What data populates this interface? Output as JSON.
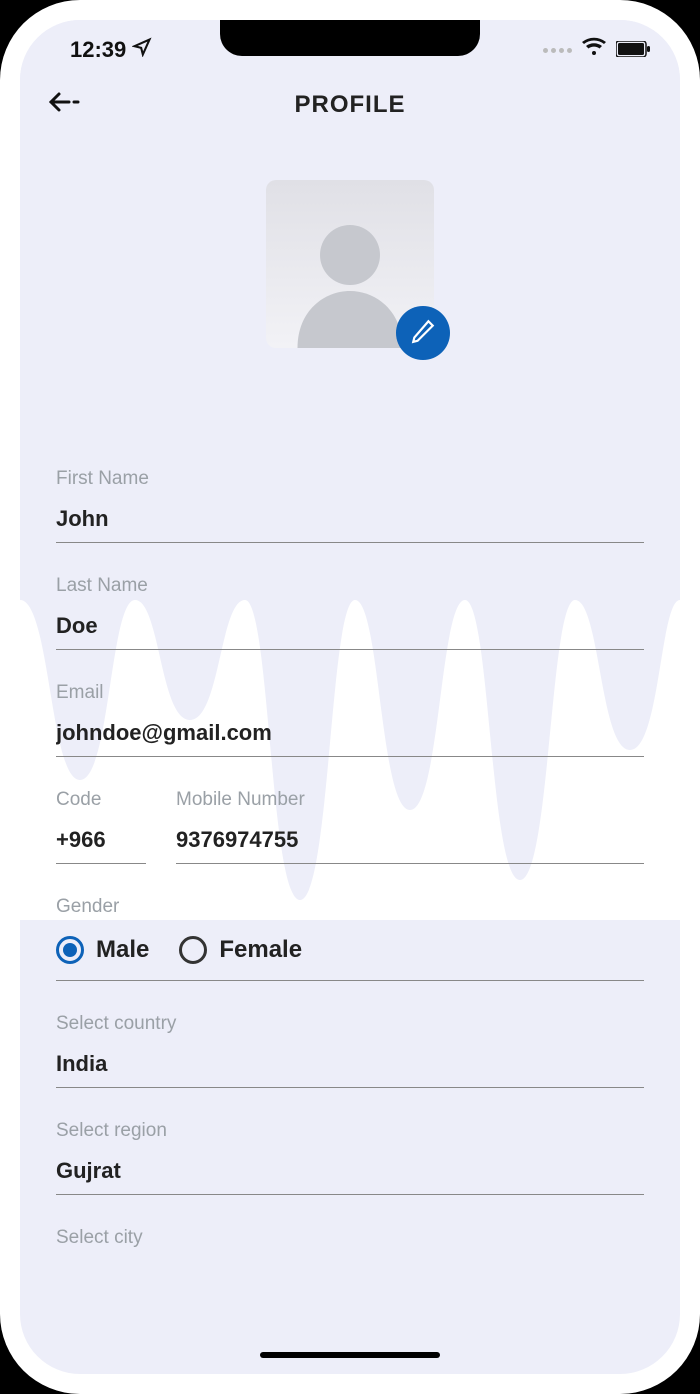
{
  "status": {
    "time": "12:39"
  },
  "header": {
    "title": "PROFILE"
  },
  "form": {
    "first_name_label": "First Name",
    "first_name": "John",
    "last_name_label": "Last Name",
    "last_name": "Doe",
    "email_label": "Email",
    "email": "johndoe@gmail.com",
    "code_label": "Code",
    "code": "+966",
    "mobile_label": "Mobile Number",
    "mobile": "9376974755",
    "gender_label": "Gender",
    "gender_male": "Male",
    "gender_female": "Female",
    "gender_selected": "male",
    "country_label": "Select country",
    "country": "India",
    "region_label": "Select region",
    "region": "Gujrat",
    "city_label": "Select city"
  }
}
